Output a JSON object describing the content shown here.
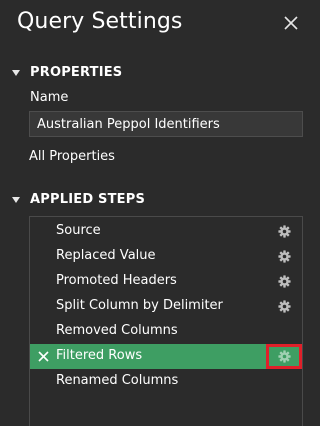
{
  "header": {
    "title": "Query Settings",
    "close_icon": "close-icon"
  },
  "properties": {
    "section_label": "PROPERTIES",
    "name_label": "Name",
    "name_value": "Australian Peppol Identifiers",
    "all_properties_link": "All Properties"
  },
  "applied_steps": {
    "section_label": "APPLIED STEPS",
    "steps": [
      {
        "label": "Source",
        "has_gear": true,
        "selected": false
      },
      {
        "label": "Replaced Value",
        "has_gear": true,
        "selected": false
      },
      {
        "label": "Promoted Headers",
        "has_gear": true,
        "selected": false
      },
      {
        "label": "Split Column by Delimiter",
        "has_gear": true,
        "selected": false
      },
      {
        "label": "Removed Columns",
        "has_gear": false,
        "selected": false
      },
      {
        "label": "Filtered Rows",
        "has_gear": true,
        "selected": true
      },
      {
        "label": "Renamed Columns",
        "has_gear": false,
        "selected": false
      }
    ]
  },
  "colors": {
    "background": "#2b2b2b",
    "selected_step": "#3e9e63",
    "highlight_box": "#e0202a"
  }
}
